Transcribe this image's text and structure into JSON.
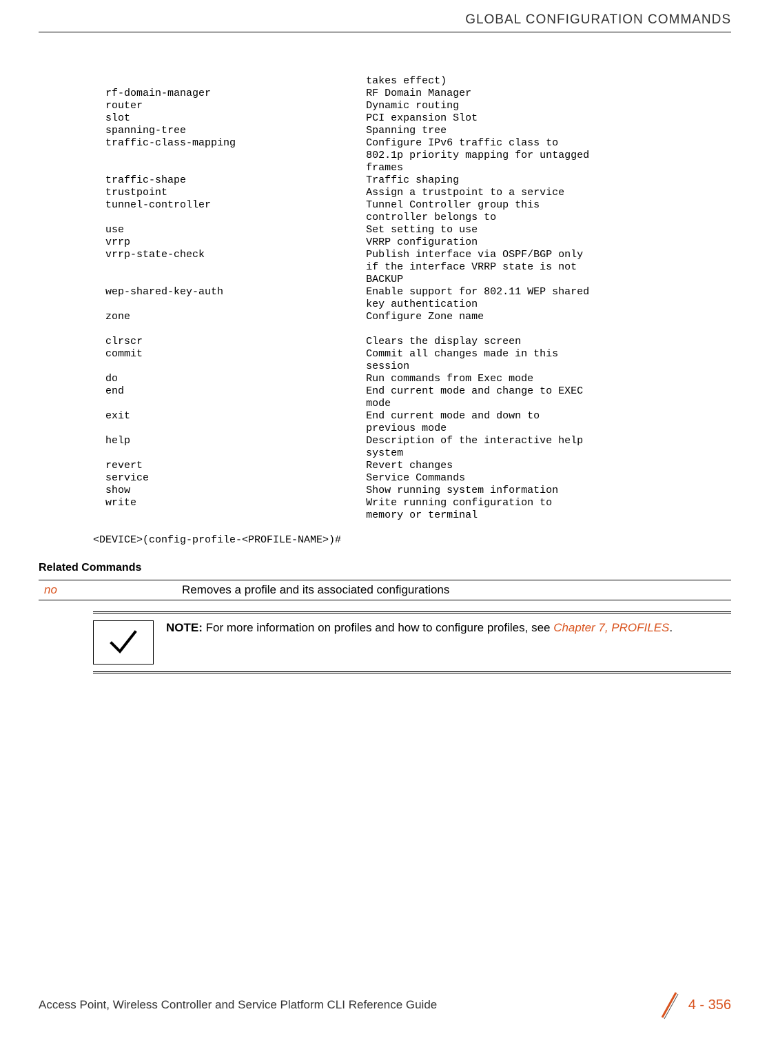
{
  "header": {
    "title": "GLOBAL CONFIGURATION COMMANDS"
  },
  "cli": {
    "cont_desc_first": "takes effect)",
    "commands1": [
      {
        "cmd": "rf-domain-manager",
        "desc": "RF Domain Manager"
      },
      {
        "cmd": "router",
        "desc": "Dynamic routing"
      },
      {
        "cmd": "slot",
        "desc": "PCI expansion Slot"
      },
      {
        "cmd": "spanning-tree",
        "desc": "Spanning tree"
      },
      {
        "cmd": "traffic-class-mapping",
        "desc": "Configure IPv6 traffic class to 802.1p priority mapping for untagged frames"
      },
      {
        "cmd": "traffic-shape",
        "desc": "Traffic shaping"
      },
      {
        "cmd": "trustpoint",
        "desc": "Assign a trustpoint to a service"
      },
      {
        "cmd": "tunnel-controller",
        "desc": "Tunnel Controller group this controller belongs to"
      },
      {
        "cmd": "use",
        "desc": "Set setting to use"
      },
      {
        "cmd": "vrrp",
        "desc": "VRRP configuration"
      },
      {
        "cmd": "vrrp-state-check",
        "desc": "Publish interface via OSPF/BGP only if the interface VRRP state is not BACKUP"
      },
      {
        "cmd": "wep-shared-key-auth",
        "desc": "Enable support for 802.11 WEP shared key authentication"
      },
      {
        "cmd": "zone",
        "desc": "Configure Zone name"
      }
    ],
    "commands2": [
      {
        "cmd": "clrscr",
        "desc": "Clears the display screen"
      },
      {
        "cmd": "commit",
        "desc": "Commit all changes made in this session"
      },
      {
        "cmd": "do",
        "desc": "Run commands from Exec mode"
      },
      {
        "cmd": "end",
        "desc": "End current mode and change to EXEC mode"
      },
      {
        "cmd": "exit",
        "desc": "End current mode and down to previous mode"
      },
      {
        "cmd": "help",
        "desc": "Description of the interactive help system"
      },
      {
        "cmd": "revert",
        "desc": "Revert changes"
      },
      {
        "cmd": "service",
        "desc": "Service Commands"
      },
      {
        "cmd": "show",
        "desc": "Show running system information"
      },
      {
        "cmd": "write",
        "desc": "Write running configuration to memory or terminal"
      }
    ],
    "prompt": "<DEVICE>(config-profile-<PROFILE-NAME>)#"
  },
  "related": {
    "heading": "Related Commands",
    "rows": [
      {
        "cmd": "no",
        "desc": "Removes a profile and its associated configurations"
      }
    ]
  },
  "note": {
    "label": "NOTE:",
    "text": " For more information on profiles and how to configure profiles, see ",
    "link": "Chapter 7, PROFILES",
    "tail": "."
  },
  "footer": {
    "left": "Access Point, Wireless Controller and Service Platform CLI Reference Guide",
    "page": "4 - 356"
  },
  "layout": {
    "indent_cmd": "  ",
    "col_cmd_width": 42,
    "col_desc_width": 36
  }
}
